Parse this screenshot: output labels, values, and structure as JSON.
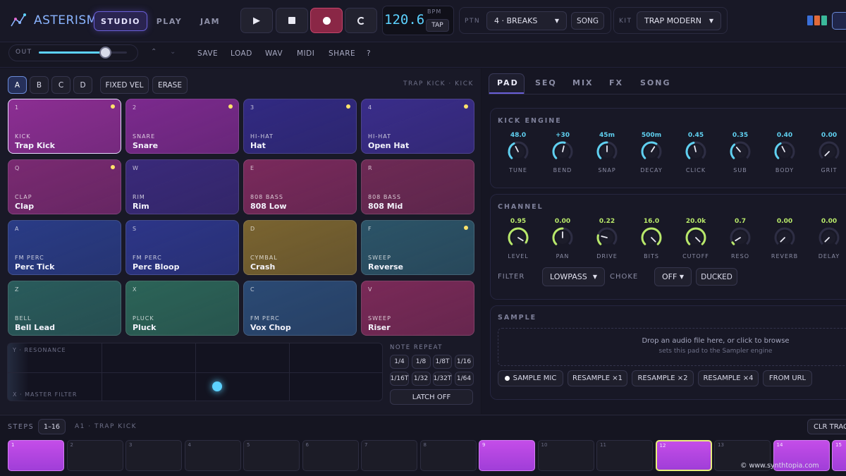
{
  "app": {
    "name": "ASTERISM"
  },
  "modes": [
    "STUDIO",
    "PLAY",
    "JAM"
  ],
  "active_mode": "STUDIO",
  "tempo": {
    "value": "120.6",
    "unit": "BPM",
    "tap_label": "TAP"
  },
  "pattern": {
    "label": "PTN",
    "value": "4 · BREAKS",
    "song_label": "SONG"
  },
  "kit": {
    "label": "KIT",
    "value": "TRAP MODERN"
  },
  "toolbar": {
    "out_label": "OUT",
    "out_level": 0.75,
    "items": [
      "SAVE",
      "LOAD",
      "WAV",
      "MIDI",
      "SHARE",
      "?"
    ]
  },
  "banks": [
    "A",
    "B",
    "C",
    "D"
  ],
  "active_bank": "A",
  "pad_tools": [
    "FIXED VEL",
    "ERASE"
  ],
  "selected_pad_label": "TRAP KICK · KICK",
  "pads": [
    {
      "key": "1",
      "category": "KICK",
      "name": "Trap Kick",
      "dot": true,
      "color": "#8c2e93"
    },
    {
      "key": "2",
      "category": "SNARE",
      "name": "Snare",
      "dot": true,
      "color": "#7c2a8e"
    },
    {
      "key": "3",
      "category": "HI-HAT",
      "name": "Hat",
      "dot": true,
      "color": "#322a82"
    },
    {
      "key": "4",
      "category": "HI-HAT",
      "name": "Open Hat",
      "dot": true,
      "color": "#3a2d8a"
    },
    {
      "key": "Q",
      "category": "CLAP",
      "name": "Clap",
      "dot": true,
      "color": "#7a2a72"
    },
    {
      "key": "W",
      "category": "RIM",
      "name": "Rim",
      "dot": false,
      "color": "#3a2a7a"
    },
    {
      "key": "E",
      "category": "808 BASS",
      "name": "808 Low",
      "dot": false,
      "color": "#7a2a5c"
    },
    {
      "key": "R",
      "category": "808 BASS",
      "name": "808 Mid",
      "dot": false,
      "color": "#6e2a55"
    },
    {
      "key": "A",
      "category": "FM PERC",
      "name": "Perc Tick",
      "dot": false,
      "color": "#2a3c86"
    },
    {
      "key": "S",
      "category": "FM PERC",
      "name": "Perc Bloop",
      "dot": false,
      "color": "#2d3688"
    },
    {
      "key": "D",
      "category": "CYMBAL",
      "name": "Crash",
      "dot": false,
      "color": "#7a6430"
    },
    {
      "key": "F",
      "category": "SWEEP",
      "name": "Reverse",
      "dot": true,
      "color": "#2c5468"
    },
    {
      "key": "Z",
      "category": "BELL",
      "name": "Bell Lead",
      "dot": false,
      "color": "#2a5c5c"
    },
    {
      "key": "X",
      "category": "PLUCK",
      "name": "Pluck",
      "dot": false,
      "color": "#2c6458"
    },
    {
      "key": "C",
      "category": "FM PERC",
      "name": "Vox Chop",
      "dot": false,
      "color": "#2b4a74"
    },
    {
      "key": "V",
      "category": "SWEEP",
      "name": "Riser",
      "dot": false,
      "color": "#7a2a58"
    }
  ],
  "xy_pad": {
    "y_label": "Y · RESONANCE",
    "x_label": "X · MASTER FILTER",
    "x_value": 0.56,
    "y_value": 0.25
  },
  "note_repeat": {
    "title": "NOTE REPEAT",
    "rates": [
      "1/4",
      "1/8",
      "1/8T",
      "1/16",
      "1/16T",
      "1/32",
      "1/32T",
      "1/64"
    ],
    "latch_label": "LATCH OFF"
  },
  "tabs": [
    "PAD",
    "SEQ",
    "MIX",
    "FX",
    "SONG"
  ],
  "active_tab": "PAD",
  "kick_engine": {
    "title": "KICK ENGINE",
    "knobs": [
      {
        "label": "TUNE",
        "value": "48.0",
        "level": 0.4
      },
      {
        "label": "BEND",
        "value": "+30",
        "level": 0.55
      },
      {
        "label": "SNAP",
        "value": "45m",
        "level": 0.5
      },
      {
        "label": "DECAY",
        "value": "500m",
        "level": 0.62
      },
      {
        "label": "CLICK",
        "value": "0.45",
        "level": 0.45
      },
      {
        "label": "SUB",
        "value": "0.35",
        "level": 0.35
      },
      {
        "label": "BODY",
        "value": "0.40",
        "level": 0.4
      },
      {
        "label": "GRIT",
        "value": "0.00",
        "level": 0.0
      }
    ]
  },
  "channel": {
    "title": "CHANNEL",
    "knobs": [
      {
        "label": "LEVEL",
        "value": "0.95",
        "level": 0.95
      },
      {
        "label": "PAN",
        "value": "0.00",
        "level": 0.5
      },
      {
        "label": "DRIVE",
        "value": "0.22",
        "level": 0.22
      },
      {
        "label": "BITS",
        "value": "16.0",
        "level": 1.0
      },
      {
        "label": "CUTOFF",
        "value": "20.0k",
        "level": 1.0
      },
      {
        "label": "RESO",
        "value": "0.7",
        "level": 0.05
      },
      {
        "label": "REVERB",
        "value": "0.00",
        "level": 0.0
      },
      {
        "label": "DELAY",
        "value": "0.00",
        "level": 0.0
      }
    ],
    "filter_label": "FILTER",
    "filter_value": "LOWPASS",
    "choke_label": "CHOKE",
    "choke_value": "OFF",
    "ducked_label": "DUCKED"
  },
  "sample": {
    "title": "SAMPLE",
    "drop_line1": "Drop an audio file here, or click to browse",
    "drop_line2": "sets this pad to the Sampler engine",
    "buttons": [
      "SAMPLE MIC",
      "RESAMPLE ×1",
      "RESAMPLE ×2",
      "RESAMPLE ×4",
      "FROM URL"
    ]
  },
  "steps": {
    "label": "STEPS",
    "range": "1–16",
    "track": "A1 · TRAP KICK",
    "clear_label": "CLR TRAC",
    "numbers": [
      "1",
      "2",
      "3",
      "4",
      "5",
      "6",
      "7",
      "8",
      "9",
      "10",
      "11",
      "12",
      "13",
      "14",
      "15"
    ],
    "active": [
      1,
      9,
      12,
      14,
      15
    ],
    "current": 12
  },
  "watermark": "© www.synthtopia.com",
  "colors": {
    "accent": "#5cd2ff",
    "step_on": "#b848e0",
    "knob_cyan": "#5fd0f0",
    "knob_lime": "#b8e86a"
  }
}
